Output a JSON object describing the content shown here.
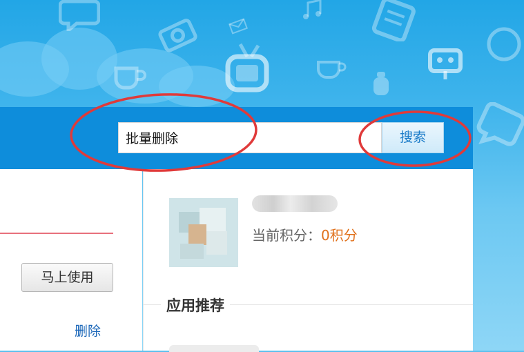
{
  "header": {
    "search_value": "批量删除",
    "search_button_label": "搜索"
  },
  "left_panel": {
    "use_button_label": "马上使用",
    "delete_link_label": "删除"
  },
  "user": {
    "points_label": "当前积分：",
    "points_value": "0积分"
  },
  "section": {
    "apps_title": "应用推荐"
  },
  "colors": {
    "header_bar": "#0e8ddb",
    "link": "#1a66b8",
    "points_accent": "#e0701a",
    "annotation": "#e03a3a"
  }
}
